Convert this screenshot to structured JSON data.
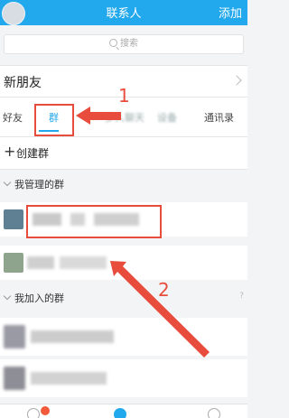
{
  "header": {
    "title": "联系人",
    "add_label": "添加"
  },
  "search": {
    "placeholder": "搜索"
  },
  "new_friends": {
    "label": "新朋友"
  },
  "tabs": [
    {
      "label": "好友",
      "active": false
    },
    {
      "label": "群",
      "active": true
    },
    {
      "label": "多人聊天",
      "active": false
    },
    {
      "label": "设备",
      "active": false
    },
    {
      "label": "通讯录",
      "active": false
    }
  ],
  "create_group": {
    "label": "创建群"
  },
  "sections": {
    "managed": {
      "label": "我管理的群"
    },
    "joined": {
      "label": "我加入的群",
      "hint": "?"
    }
  },
  "annotations": {
    "step1": "1",
    "step2": "2"
  },
  "colors": {
    "accent": "#22a8ec",
    "annotation": "#e74c3c"
  }
}
